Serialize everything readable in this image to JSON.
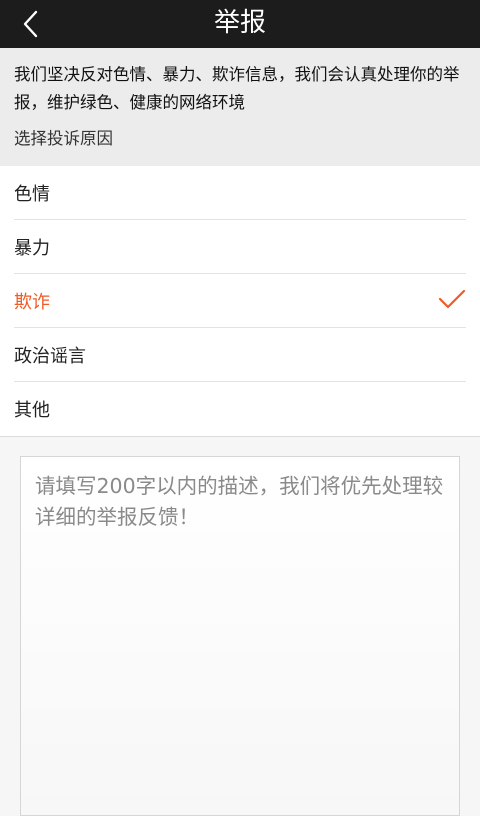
{
  "header": {
    "title": "举报",
    "back_icon": "chevron-left-icon"
  },
  "notice": {
    "text": "我们坚决反对色情、暴力、欺诈信息，我们会认真处理你的举报，维护绿色、健康的网络环境",
    "section_label": "选择投诉原因"
  },
  "reasons": [
    {
      "label": "色情",
      "selected": false
    },
    {
      "label": "暴力",
      "selected": false
    },
    {
      "label": "欺诈",
      "selected": true
    },
    {
      "label": "政治谣言",
      "selected": false
    },
    {
      "label": "其他",
      "selected": false
    }
  ],
  "description": {
    "value": "",
    "placeholder": "请填写200字以内的描述，我们将优先处理较详细的举报反馈！"
  },
  "colors": {
    "accent": "#f15a24",
    "topbar": "#1c1c1c"
  }
}
